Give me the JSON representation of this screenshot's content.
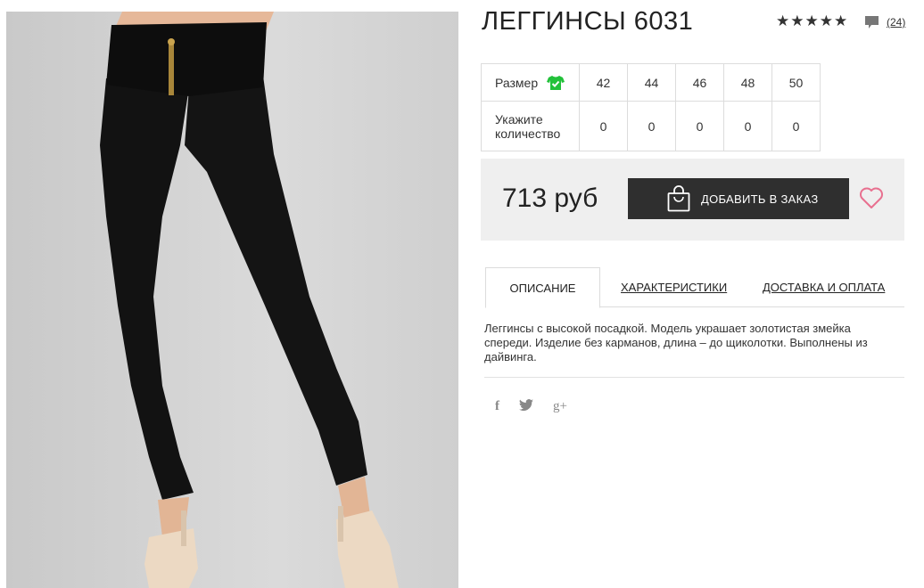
{
  "product": {
    "title": "ЛЕГГИНСЫ 6031",
    "rating_stars": [
      "★",
      "★",
      "★",
      "★",
      "★"
    ],
    "rating_value": 5,
    "reviews_count": "(24)"
  },
  "size_table": {
    "size_label": "Размер",
    "quantity_label": "Укажите количество",
    "sizes": [
      "42",
      "44",
      "46",
      "48",
      "50"
    ],
    "quantities": [
      "0",
      "0",
      "0",
      "0",
      "0"
    ]
  },
  "purchase": {
    "price": "713 руб",
    "order_button": "ДОБАВИТЬ В ЗАКАЗ"
  },
  "tabs": {
    "description": "ОПИСАНИЕ",
    "characteristics": "ХАРАКТЕРИСТИКИ",
    "delivery": "ДОСТАВКА И ОПЛАТА"
  },
  "description_text": "Леггинсы с высокой посадкой. Модель украшает золотистая змейка спереди. Изделие без карманов, длина – до щиколотки. Выполнены из дайвинга.",
  "social": {
    "facebook": "f",
    "twitter": "🐦",
    "google_plus": "g+"
  },
  "colors": {
    "button_bg": "#2f2f2f",
    "price_box_bg": "#efefef",
    "size_check_green": "#22c13a",
    "heart_pink": "#e8708f"
  },
  "icons": {
    "star": "star-icon",
    "comment": "comment-icon",
    "size_guide": "tshirt-check-icon",
    "bag": "shopping-bag-icon",
    "favorite": "heart-icon"
  }
}
